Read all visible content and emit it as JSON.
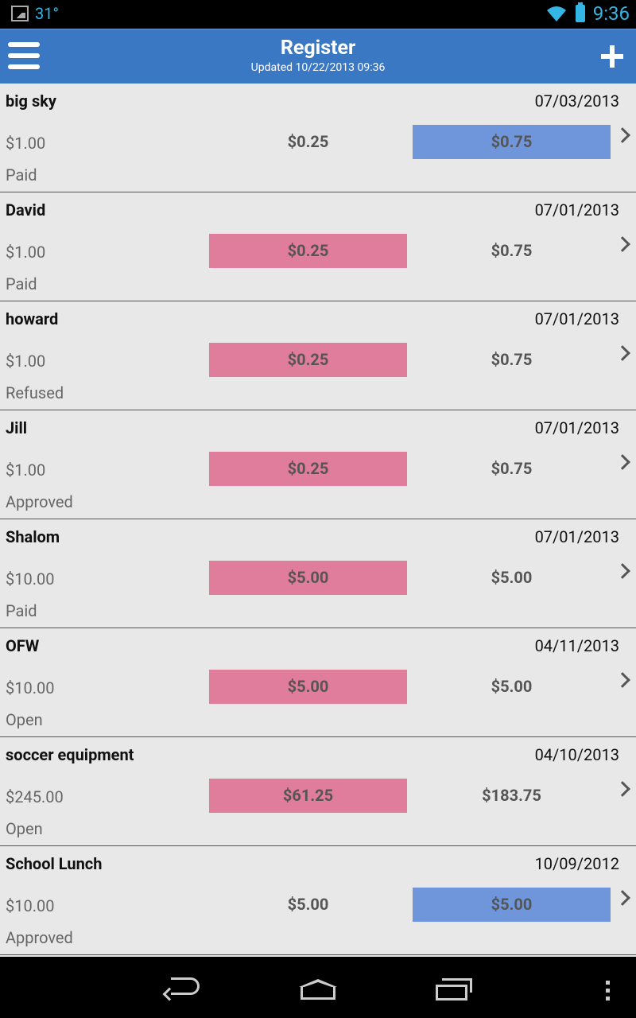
{
  "status_bar": {
    "temperature": "31°",
    "time": "9:36"
  },
  "action_bar": {
    "title": "Register",
    "subtitle": "Updated 10/22/2013 09:36"
  },
  "colors": {
    "action_bar": "#3b78c4",
    "highlight_pink": "#e07c9c",
    "highlight_blue": "#6f96da",
    "list_background": "#e8e8e8"
  },
  "rows": [
    {
      "name": "big sky",
      "date": "07/03/2013",
      "total": "$1.00",
      "amount_1": "$0.25",
      "amount_2": "$0.75",
      "status": "Paid",
      "highlight": "amount_2",
      "highlight_color": "blue"
    },
    {
      "name": "David",
      "date": "07/01/2013",
      "total": "$1.00",
      "amount_1": "$0.25",
      "amount_2": "$0.75",
      "status": "Paid",
      "highlight": "amount_1",
      "highlight_color": "pink"
    },
    {
      "name": "howard",
      "date": "07/01/2013",
      "total": "$1.00",
      "amount_1": "$0.25",
      "amount_2": "$0.75",
      "status": "Refused",
      "highlight": "amount_1",
      "highlight_color": "pink"
    },
    {
      "name": "Jill",
      "date": "07/01/2013",
      "total": "$1.00",
      "amount_1": "$0.25",
      "amount_2": "$0.75",
      "status": "Approved",
      "highlight": "amount_1",
      "highlight_color": "pink"
    },
    {
      "name": "Shalom",
      "date": "07/01/2013",
      "total": "$10.00",
      "amount_1": "$5.00",
      "amount_2": "$5.00",
      "status": "Paid",
      "highlight": "amount_1",
      "highlight_color": "pink"
    },
    {
      "name": "OFW",
      "date": "04/11/2013",
      "total": "$10.00",
      "amount_1": "$5.00",
      "amount_2": "$5.00",
      "status": "Open",
      "highlight": "amount_1",
      "highlight_color": "pink"
    },
    {
      "name": "soccer equipment",
      "date": "04/10/2013",
      "total": "$245.00",
      "amount_1": "$61.25",
      "amount_2": "$183.75",
      "status": "Open",
      "highlight": "amount_1",
      "highlight_color": "pink"
    },
    {
      "name": "School Lunch",
      "date": "10/09/2012",
      "total": "$10.00",
      "amount_1": "$5.00",
      "amount_2": "$5.00",
      "status": "Approved",
      "highlight": "amount_2",
      "highlight_color": "blue"
    }
  ],
  "icons": {
    "menu": "hamburger-menu-icon",
    "add": "plus-icon",
    "row_arrow": "chevron-right-icon",
    "nav_back": "back-icon",
    "nav_home": "home-icon",
    "nav_recent": "recent-apps-icon",
    "nav_overflow": "overflow-menu-icon"
  }
}
